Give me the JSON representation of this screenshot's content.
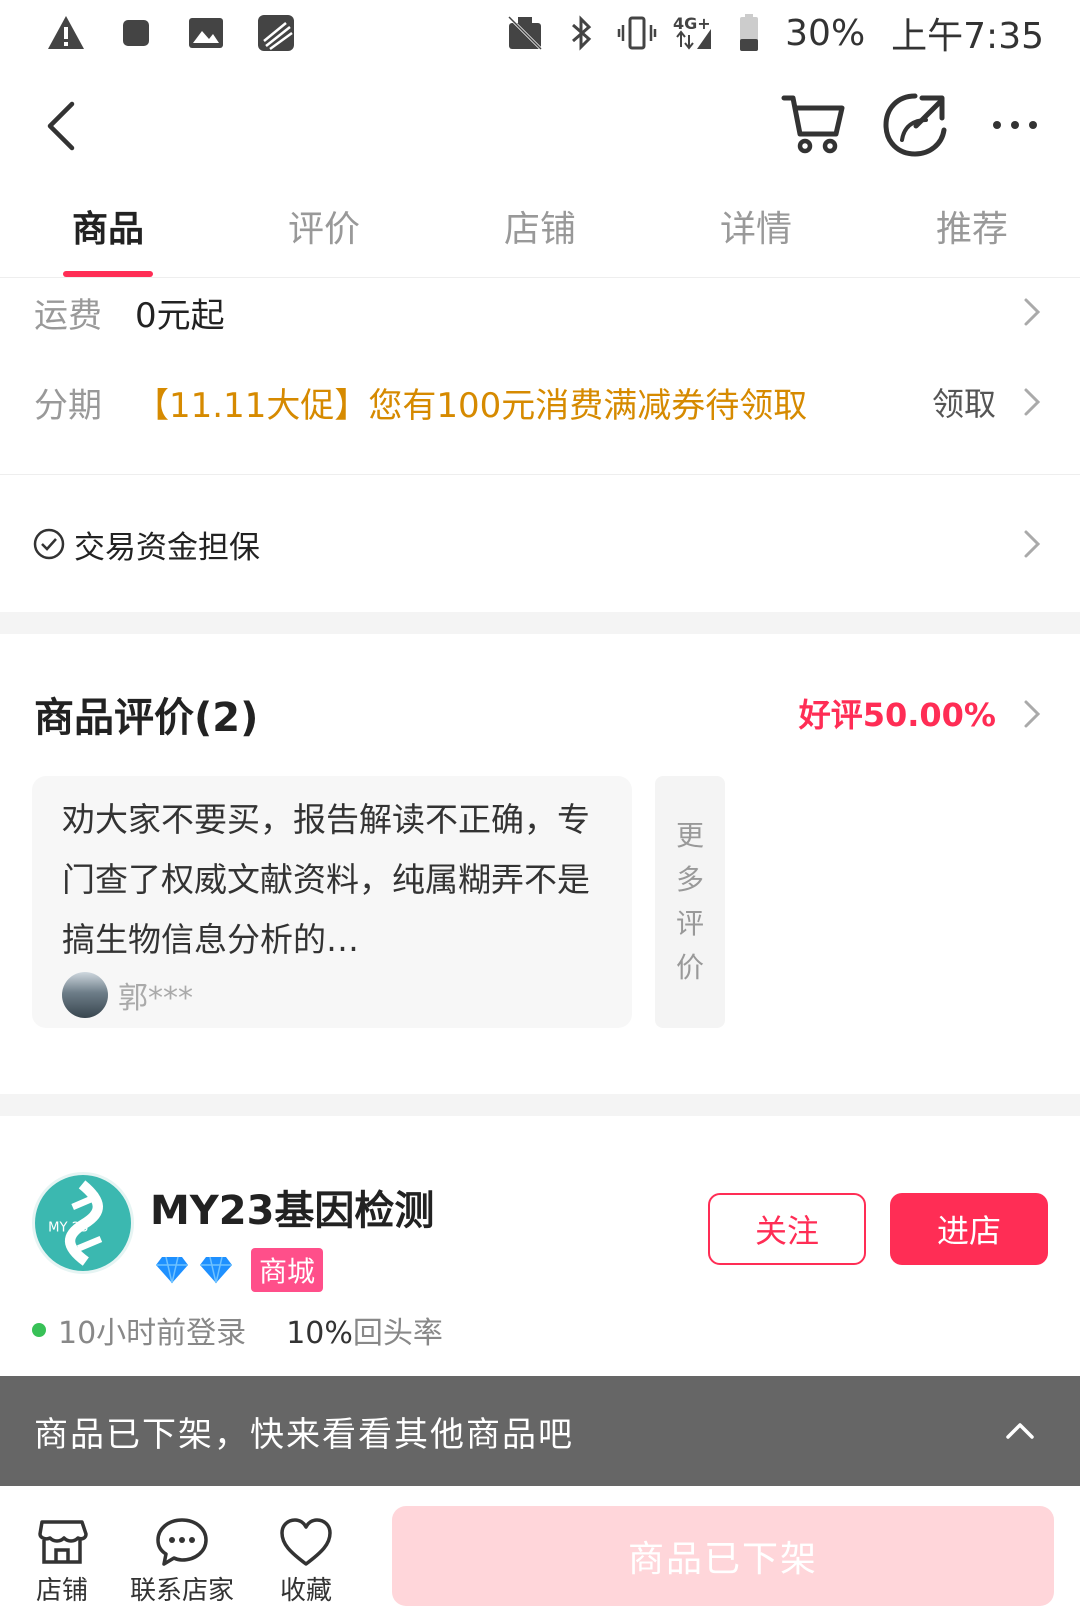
{
  "status_bar": {
    "battery": "30%",
    "time": "上午7:35",
    "network": "4G+"
  },
  "tabs": [
    {
      "label": "商品",
      "active": true
    },
    {
      "label": "评价",
      "active": false
    },
    {
      "label": "店铺",
      "active": false
    },
    {
      "label": "详情",
      "active": false
    },
    {
      "label": "推荐",
      "active": false
    }
  ],
  "shipping": {
    "label": "运费",
    "value": "0元起"
  },
  "installment": {
    "label": "分期",
    "promo": "【11.11大促】您有100元消费满减券待领取",
    "action": "领取"
  },
  "guarantee": {
    "label": "交易资金担保"
  },
  "reviews": {
    "title": "商品评价(2)",
    "positive_rate": "好评50.00%",
    "items": [
      {
        "text": "劝大家不要买，报告解读不正确，专门查了权威文献资料，纯属糊弄不是搞生物信息分析的…",
        "user": "郭***"
      }
    ],
    "more_label": [
      "更",
      "多",
      "评",
      "价"
    ]
  },
  "shop": {
    "name": "MY23基因检测",
    "logo_text": "MY 23",
    "mall_badge": "商城",
    "follow_label": "关注",
    "enter_label": "进店",
    "last_login": "10小时前登录",
    "return_rate_value": "10%",
    "return_rate_label": "回头率"
  },
  "banner": {
    "text": "商品已下架，快来看看其他商品吧"
  },
  "bottom_bar": {
    "store_label": "店铺",
    "contact_label": "联系店家",
    "favorite_label": "收藏",
    "status_button": "商品已下架"
  },
  "colors": {
    "accent": "#ff2d55",
    "promo": "#d68a00",
    "logo": "#3bb8b0"
  }
}
